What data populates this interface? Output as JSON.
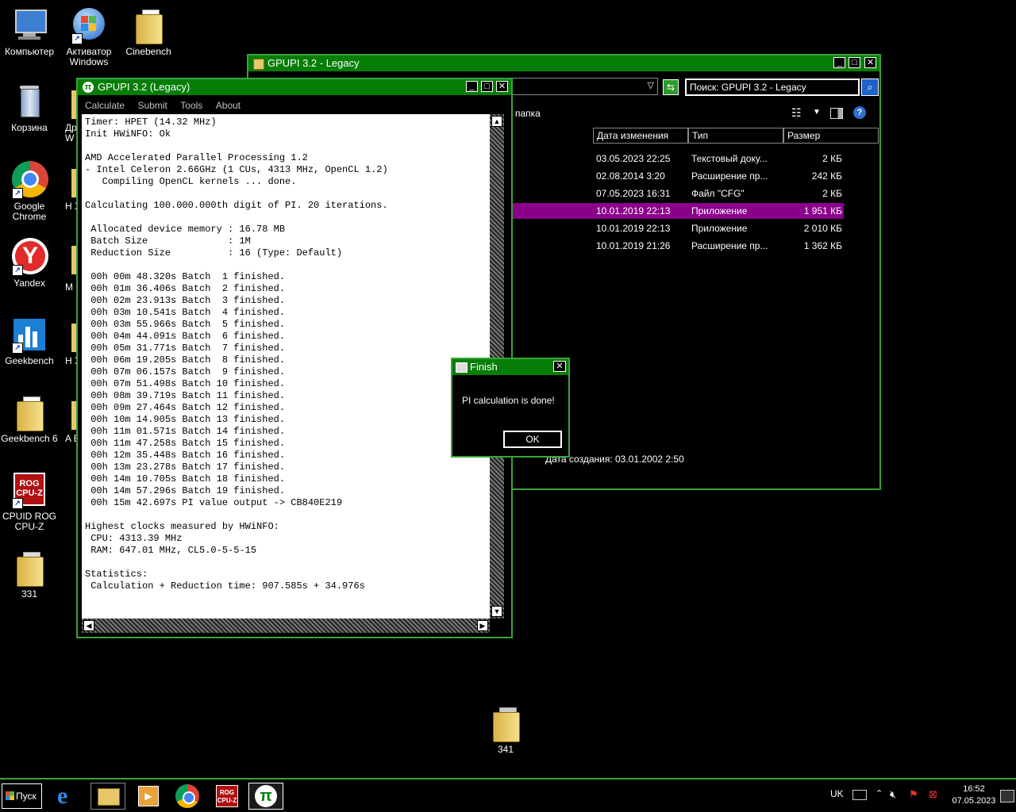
{
  "desktop": {
    "icons": [
      {
        "label": "Компьютер"
      },
      {
        "label": "Активатор Windows"
      },
      {
        "label": "Cinebench"
      },
      {
        "label": "Корзина"
      },
      {
        "label": "Др W"
      },
      {
        "label": "Google Chrome"
      },
      {
        "label": "H X"
      },
      {
        "label": "Yandex"
      },
      {
        "label": "M"
      },
      {
        "label": "Geekbench"
      },
      {
        "label": "H X"
      },
      {
        "label": "Geekbench 6"
      },
      {
        "label": "A E"
      },
      {
        "label": "CPUID ROG CPU-Z"
      },
      {
        "label": "331"
      },
      {
        "label": "341"
      }
    ]
  },
  "explorer": {
    "title": "GPUPI 3.2 - Legacy",
    "search_value": "Поиск: GPUPI 3.2 - Legacy",
    "breadcrumb_fragment": "папка",
    "columns": [
      "Дата изменения",
      "Тип",
      "Размер"
    ],
    "rows": [
      {
        "date": "03.05.2023 22:25",
        "type": "Текстовый доку...",
        "size": "2 КБ",
        "selected": false
      },
      {
        "date": "02.08.2014 3:20",
        "type": "Расширение пр...",
        "size": "242 КБ",
        "selected": false
      },
      {
        "date": "07.05.2023 16:31",
        "type": "Файл \"CFG\"",
        "size": "2 КБ",
        "selected": false
      },
      {
        "date": "10.01.2019 22:13",
        "type": "Приложение",
        "size": "1 951 КБ",
        "selected": true
      },
      {
        "date": "10.01.2019 22:13",
        "type": "Приложение",
        "size": "2 010 КБ",
        "selected": false
      },
      {
        "date": "10.01.2019 21:26",
        "type": "Расширение пр...",
        "size": "1 362 КБ",
        "selected": false
      }
    ],
    "details_text": "Дата создания: 03.01.2002 2:50",
    "selected_color": "#8b008b"
  },
  "gpupi": {
    "title": "GPUPI 3.2 (Legacy)",
    "menu": [
      "Calculate",
      "Submit",
      "Tools",
      "About"
    ],
    "console_lines": [
      "Timer: HPET (14.32 MHz)",
      "Init HWiNFO: Ok",
      "",
      "AMD Accelerated Parallel Processing 1.2",
      "- Intel Celeron 2.66GHz (1 CUs, 4313 MHz, OpenCL 1.2)",
      "   Compiling OpenCL kernels ... done.",
      "",
      "Calculating 100.000.000th digit of PI. 20 iterations.",
      "",
      " Allocated device memory : 16.78 MB",
      " Batch Size              : 1M",
      " Reduction Size          : 16 (Type: Default)",
      "",
      " 00h 00m 48.320s Batch  1 finished.",
      " 00h 01m 36.406s Batch  2 finished.",
      " 00h 02m 23.913s Batch  3 finished.",
      " 00h 03m 10.541s Batch  4 finished.",
      " 00h 03m 55.966s Batch  5 finished.",
      " 00h 04m 44.091s Batch  6 finished.",
      " 00h 05m 31.771s Batch  7 finished.",
      " 00h 06m 19.205s Batch  8 finished.",
      " 00h 07m 06.157s Batch  9 finished.",
      " 00h 07m 51.498s Batch 10 finished.",
      " 00h 08m 39.719s Batch 11 finished.",
      " 00h 09m 27.464s Batch 12 finished.",
      " 00h 10m 14.905s Batch 13 finished.",
      " 00h 11m 01.571s Batch 14 finished.",
      " 00h 11m 47.258s Batch 15 finished.",
      " 00h 12m 35.448s Batch 16 finished.",
      " 00h 13m 23.278s Batch 17 finished.",
      " 00h 14m 10.705s Batch 18 finished.",
      " 00h 14m 57.296s Batch 19 finished.",
      " 00h 15m 42.697s PI value output -> CB840E219",
      "",
      "Highest clocks measured by HWiNFO:",
      " CPU: 4313.39 MHz",
      " RAM: 647.01 MHz, CL5.0-5-5-15",
      "",
      "Statistics:",
      " Calculation + Reduction time: 907.585s + 34.976s"
    ]
  },
  "dialog": {
    "title": "Finish",
    "message": "PI calculation is done!",
    "ok_label": "OK"
  },
  "taskbar": {
    "start_label": "Пуск",
    "language": "UK",
    "time": "16:52",
    "date": "07.05.2023",
    "accent": "#3aa33a"
  }
}
